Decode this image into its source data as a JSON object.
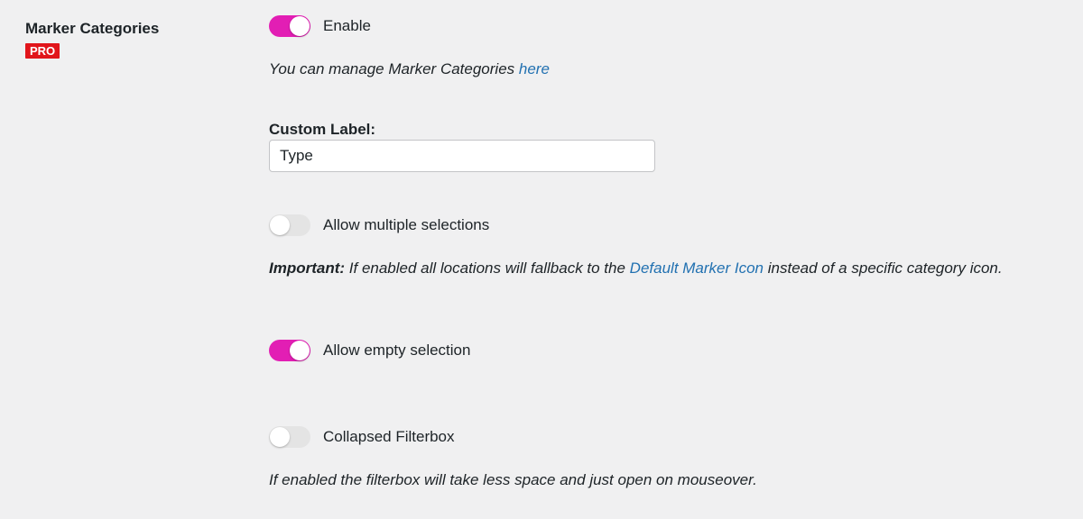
{
  "section": {
    "title": "Marker Categories",
    "badge": "PRO"
  },
  "enable": {
    "label": "Enable",
    "checked": true
  },
  "manage_note": {
    "text": "You can manage Marker Categories ",
    "link": "here"
  },
  "custom_label": {
    "label": "Custom Label:",
    "value": "Type"
  },
  "multiple_selections": {
    "label": "Allow multiple selections",
    "checked": false
  },
  "important_note": {
    "strong": "Important:",
    "text_before": " If enabled all locations will fallback to the ",
    "link": "Default Marker Icon",
    "text_after": " instead of a specific category icon."
  },
  "empty_selection": {
    "label": "Allow empty selection",
    "checked": true
  },
  "collapsed_filterbox": {
    "label": "Collapsed Filterbox",
    "checked": false
  },
  "filterbox_note": {
    "text": "If enabled the filterbox will take less space and just open on mouseover."
  },
  "colors": {
    "toggle_on": "#e21eb4",
    "toggle_off": "#e4e4e4",
    "link": "#2271b1",
    "badge": "#e1151b",
    "background": "#f0f0f1"
  }
}
